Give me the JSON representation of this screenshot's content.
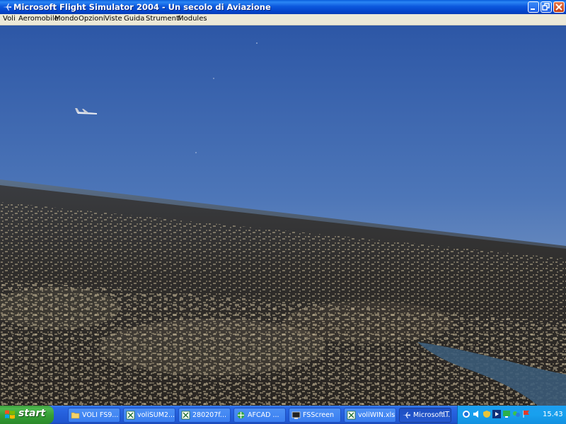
{
  "window": {
    "title": "Microsoft Flight Simulator 2004 - Un secolo di Aviazione",
    "icon": "plane-icon"
  },
  "menu": [
    "Voli",
    "Aeromobile",
    "Mondo",
    "Opzioni",
    "Viste",
    "Guida",
    "Strumenti",
    "Modules"
  ],
  "taskbar": {
    "start_label": "start",
    "tasks": [
      {
        "label": "VOLI FS9...",
        "icon": "folder-icon",
        "active": false
      },
      {
        "label": "voliSUM2...",
        "icon": "excel-icon",
        "active": false
      },
      {
        "label": "280207f...",
        "icon": "excel-icon",
        "active": false
      },
      {
        "label": "AFCAD ...",
        "icon": "afcad-icon",
        "active": false
      },
      {
        "label": "FSScreen",
        "icon": "fsscreen-icon",
        "active": false
      },
      {
        "label": "voliWIN.xls",
        "icon": "excel-icon",
        "active": false
      },
      {
        "label": "Microsoft...",
        "icon": "plane-icon",
        "active": true
      }
    ],
    "language": "IT",
    "clock": "15.43"
  },
  "colors": {
    "sky_top": "#2f5aa8",
    "sky_horizon": "#8aa8c8",
    "ground": "#2b2826",
    "river": "#3a5a78"
  }
}
